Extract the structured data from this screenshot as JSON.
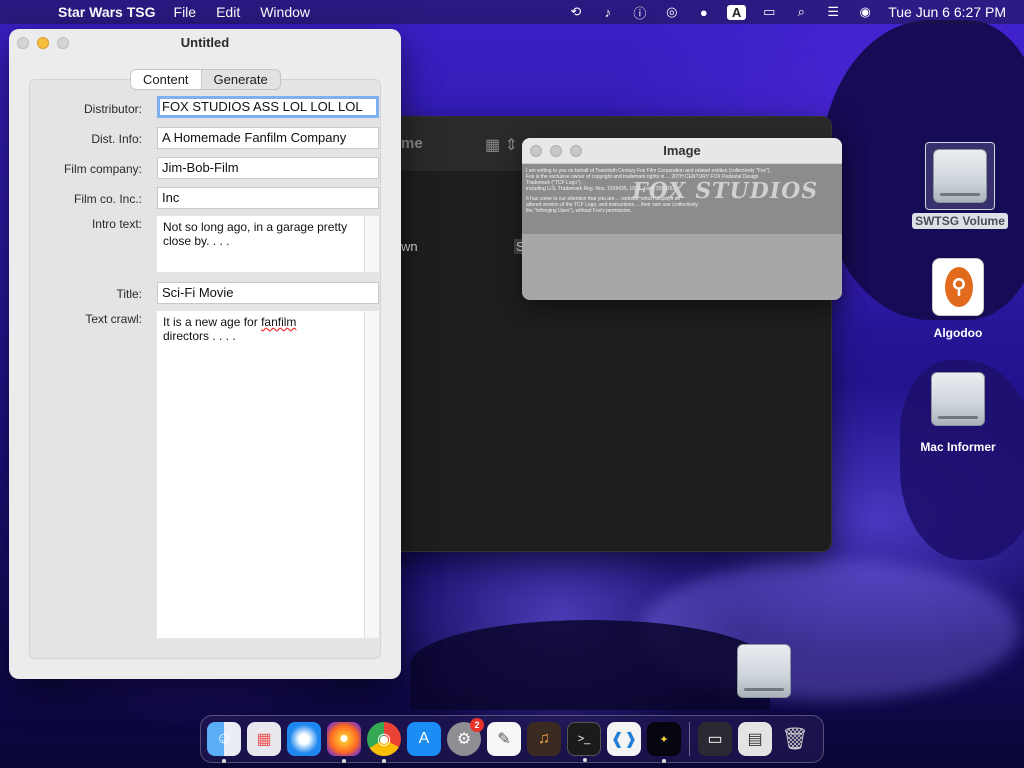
{
  "menubar": {
    "app_name": "Star Wars TSG",
    "menus": [
      "File",
      "Edit",
      "Window"
    ],
    "input_indicator": "A",
    "clock": "Tue Jun 6  6:27 PM"
  },
  "main_window": {
    "title": "Untitled",
    "tabs": [
      "Content",
      "Generate"
    ],
    "active_tab": "Content",
    "fields": {
      "distributor": {
        "label": "Distributor:",
        "value": "FOX STUDIOS ASS LOL LOL LOL"
      },
      "dist_info": {
        "label": "Dist. Info:",
        "value": "A Homemade Fanfilm Company"
      },
      "film_company": {
        "label": "Film company:",
        "value": "Jim-Bob-Film"
      },
      "film_co_inc": {
        "label": "Film co. Inc.:",
        "value": "Inc"
      },
      "intro_text": {
        "label": "Intro text:",
        "value": "Not so long ago, in a garage pretty close by. . . ."
      },
      "title": {
        "label": "Title:",
        "value": "Sci-Fi Movie"
      },
      "text_crawl": {
        "label": "Text crawl:",
        "value_part1": "It is a new age for ",
        "value_misspelled": "fanfilm",
        "value_part2": "directors . . . ."
      }
    }
  },
  "image_window": {
    "title": "Image",
    "letter_line1": "I am writing to you on behalf of Twentieth Century Fox Film Corporation and related entities (collectively \"Fox\").",
    "letter_line2": "Fox is the exclusive owner of copyright and trademark rights in ... 20TH CENTURY FOX Pedestal Design",
    "letter_line3": "Trademark (\"TCF Logo\"),",
    "letter_line4": "including U.S. Trademark Reg. Nos. 1928435, 1928... and 3550261.",
    "letter_line5": "It has come to our attention that you are ... website, which displays an",
    "letter_line6": "altered version of the TCF Logo, and instructions ... their own use (collectively",
    "letter_line7": "the \"Infringing Uses\"), without Fox's permission.",
    "logo_text": "FOX STUDIOS"
  },
  "background_window": {
    "title_fragment": "me",
    "text_fragment": "wn",
    "text_fragment2": "S"
  },
  "desktop_icons": [
    {
      "label": "SWTSG Volume",
      "icon": "drive-icon",
      "selected": true
    },
    {
      "label": "Algodoo",
      "icon": "algodoo-app-icon"
    },
    {
      "label": "Mac Informer",
      "icon": "drive-icon"
    },
    {
      "label": "",
      "icon": "drive-icon"
    }
  ],
  "dock": {
    "apps": [
      "Finder",
      "Launchpad",
      "Safari",
      "Firefox",
      "Chrome",
      "App Store",
      "System Settings",
      "TextEdit",
      "GarageBand",
      "Terminal",
      "Visual Studio Code",
      "Star Wars TSG"
    ],
    "system_settings_badge": "2"
  },
  "colors": {
    "focus_ring": "#7fb0ee",
    "window_bg": "#ececec",
    "minimize_yellow": "#f6bd3b",
    "wallpaper_primary": "#2a18a0"
  }
}
